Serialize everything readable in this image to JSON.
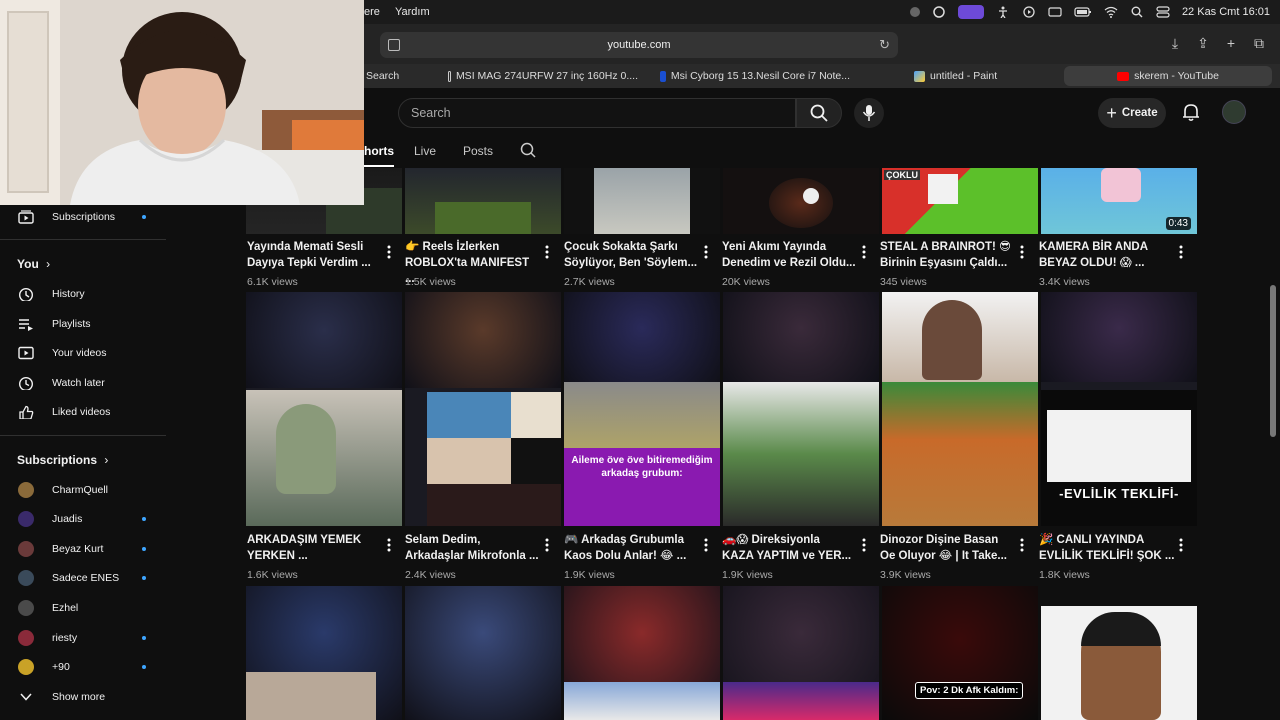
{
  "menubar": {
    "items": [
      "ere",
      "Yardım"
    ],
    "date_time": "22 Kas Cmt  16:01"
  },
  "browser": {
    "url": "youtube.com",
    "tabs": [
      {
        "label": "Search",
        "color": "#888888"
      },
      {
        "label": "MSI MAG 274URFW 27 inç 160Hz 0....",
        "color": "#cccccc"
      },
      {
        "label": "Msi Cyborg 15 13.Nesil Core i7 Note...",
        "color": "#1a4fd1"
      },
      {
        "label": "untitled - Paint",
        "color": "#4aa3ff"
      },
      {
        "label": "skerem - YouTube",
        "color": "#ff0000"
      }
    ]
  },
  "youtube": {
    "search_placeholder": "Search",
    "create_label": "Create",
    "channel_tabs": [
      "horts",
      "Live",
      "Posts"
    ]
  },
  "sidebar": {
    "top_item": "Subscriptions",
    "you_label": "You",
    "you_items": [
      "History",
      "Playlists",
      "Your videos",
      "Watch later",
      "Liked videos"
    ],
    "subs_label": "Subscriptions",
    "subs": [
      {
        "name": "CharmQuell",
        "dot": false,
        "color": "#8a6a3a"
      },
      {
        "name": "Juadis",
        "dot": true,
        "color": "#3a2a6a"
      },
      {
        "name": "Beyaz Kurt",
        "dot": true,
        "color": "#6a3a3a"
      },
      {
        "name": "Sadece ENES",
        "dot": true,
        "color": "#3a4a5a"
      },
      {
        "name": "Ezhel",
        "dot": false,
        "color": "#4a4a4a"
      },
      {
        "name": "riesty",
        "dot": true,
        "color": "#8a2a3a"
      },
      {
        "name": "+90",
        "dot": true,
        "color": "#c9a227"
      }
    ],
    "show_more": "Show more"
  },
  "videos_row1": [
    {
      "title1": "Yayında Memati Sesli",
      "title2": "Dayıya Tepki Verdim ...",
      "views": "6.1K views"
    },
    {
      "title1": "👉 Reels İzlerken",
      "title2": "ROBLOX'ta MANIFEST ...",
      "views": "1.5K views"
    },
    {
      "title1": "Çocuk Sokakta Şarkı",
      "title2": "Söylüyor, Ben 'Söylem...",
      "views": "2.7K views"
    },
    {
      "title1": "Yeni Akımı Yayında",
      "title2": "Denedim ve Rezil Oldu...",
      "views": "20K views"
    },
    {
      "title1": "STEAL A BRAINROT! 😎",
      "title2": "Birinin Eşyasını Çaldı...",
      "views": "345 views"
    },
    {
      "title1": "KAMERA BİR ANDA",
      "title2": "BEYAZ OLDU! 😱 ...",
      "views": "3.4K views",
      "duration": "0:43"
    }
  ],
  "videos_row2": [
    {
      "title1": "ARKADAŞIM YEMEK",
      "title2": "YERKEN ...",
      "views": "1.6K views"
    },
    {
      "title1": "Selam Dedim,",
      "title2": "Arkadaşlar Mikrofonla ...",
      "views": "2.4K views"
    },
    {
      "title1": "🎮 Arkadaş Grubumla",
      "title2": "Kaos Dolu Anlar! 😂 ...",
      "views": "1.9K views"
    },
    {
      "title1": "🚗😱 Direksiyonla",
      "title2": "KAZA YAPTIM ve YER...",
      "views": "1.9K views"
    },
    {
      "title1": "Dinozor Dişine Basan",
      "title2": "Oe Oluyor 😂 | It Take...",
      "views": "3.9K views"
    },
    {
      "title1": "🎉 CANLI YAYINDA",
      "title2": "EVLİLİK TEKLİFİ! ŞOK ...",
      "views": "1.8K views"
    }
  ],
  "thumb_overlays": {
    "row1_5_tag": "ÇOKLU",
    "row2_3_caption": "Aileme öve öve bitiremediğim arkadaş grubum:",
    "row2_6_banner": "-EVLİLİK TEKLİFİ-",
    "row3_5_caption": "Pov: 2 Dk Afk Kaldım:"
  }
}
